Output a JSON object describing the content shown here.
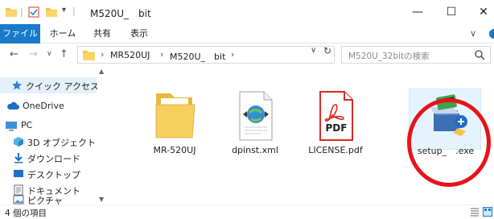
{
  "window": {
    "title": "M520U_　bit",
    "minimize": "—",
    "maximize": "☐",
    "close": "✕"
  },
  "ribbon": {
    "tabs": [
      "ファイル",
      "ホーム",
      "共有",
      "表示"
    ]
  },
  "address": {
    "crumbs": [
      "MR520UJ",
      "M520U_　bit"
    ],
    "search_placeholder": "M520U_32bitの検索"
  },
  "sidebar": {
    "items": [
      {
        "label": "クイック アクセス",
        "icon": "star-icon"
      },
      {
        "label": "OneDrive",
        "icon": "cloud-icon"
      },
      {
        "label": "PC",
        "icon": "pc-icon"
      },
      {
        "label": "3D オブジェクト",
        "icon": "3d-objects-icon"
      },
      {
        "label": "ダウンロード",
        "icon": "download-icon"
      },
      {
        "label": "デスクトップ",
        "icon": "desktop-icon"
      },
      {
        "label": "ドキュメント",
        "icon": "document-icon"
      },
      {
        "label": "ピクチャ",
        "icon": "pictures-icon"
      }
    ]
  },
  "files": [
    {
      "name": "MR-520UJ",
      "icon": "folder-icon"
    },
    {
      "name": "dpinst.xml",
      "icon": "xml-file-icon"
    },
    {
      "name": "LICENSE.pdf",
      "icon": "pdf-file-icon",
      "badge": "PDF"
    },
    {
      "name": "setup_　.exe",
      "icon": "installer-icon"
    }
  ],
  "status": {
    "item_count": "4 個の項目"
  },
  "colors": {
    "accent": "#1979ca",
    "highlight": "#e8121a",
    "folder": "#f4c542"
  }
}
